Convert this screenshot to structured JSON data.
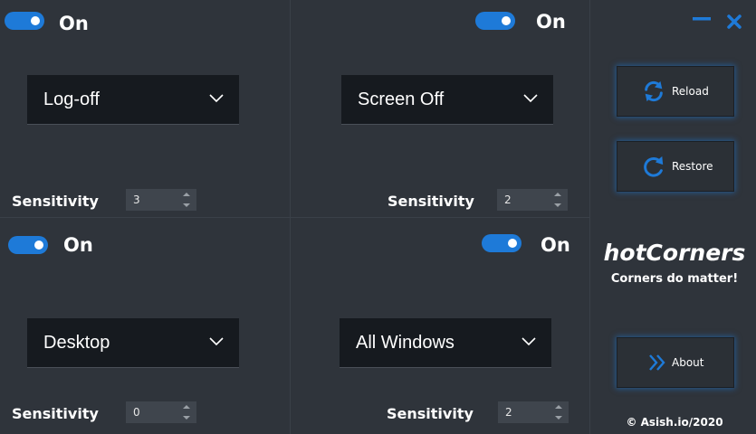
{
  "app": {
    "name": "hotCorners",
    "tagline": "Corners do matter!",
    "copyright": "© Asish.io/2020"
  },
  "colors": {
    "background": "#2f343b",
    "accent": "#1e7ad8",
    "dropdown_bg": "#161a1f",
    "spinner_bg": "#3f454d",
    "text": "#ffffff"
  },
  "window_controls": {
    "minimize_icon": "minimize-icon",
    "close_icon": "close-icon"
  },
  "sensitivity_label": "Sensitivity",
  "corners": {
    "top_left": {
      "toggle_state": "On",
      "enabled": true,
      "action": "Log-off",
      "sensitivity": "3"
    },
    "top_right": {
      "toggle_state": "On",
      "enabled": true,
      "action": "Screen Off",
      "sensitivity": "2"
    },
    "bottom_left": {
      "toggle_state": "On",
      "enabled": true,
      "action": "Desktop",
      "sensitivity": "0"
    },
    "bottom_right": {
      "toggle_state": "On",
      "enabled": true,
      "action": "All Windows",
      "sensitivity": "2"
    }
  },
  "side_buttons": {
    "reload": {
      "label": "Reload",
      "icon": "refresh-icon"
    },
    "restore": {
      "label": "Restore",
      "icon": "restore-icon"
    },
    "about": {
      "label": "About",
      "icon": "double-chevron-right-icon"
    }
  }
}
